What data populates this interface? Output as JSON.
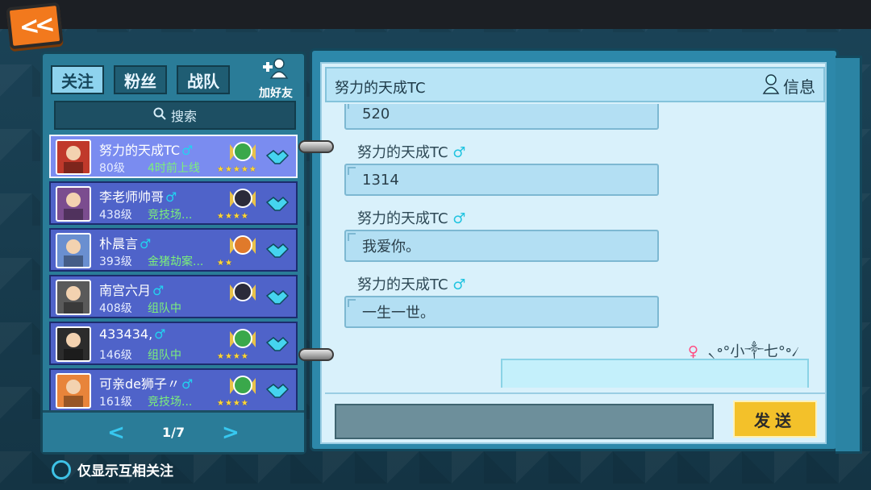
{
  "back_button": {
    "label": "<<"
  },
  "left_panel": {
    "tabs": [
      {
        "label": "关注",
        "active": true
      },
      {
        "label": "粉丝",
        "active": false
      },
      {
        "label": "战队",
        "active": false
      }
    ],
    "add_friend": {
      "icon": "+",
      "label": "加好友"
    },
    "search": {
      "icon": "search-icon",
      "label": "搜索"
    },
    "friends": [
      {
        "name": "努力的天成TC",
        "gender": "♂",
        "level": "80级",
        "status": "4时前上线",
        "stars": "★★★★★",
        "badge_color": "#3aa84b",
        "avatar_color": "#c0392b",
        "selected": true
      },
      {
        "name": "李老师帅哥",
        "gender": "♂",
        "level": "438级",
        "status": "竞技场...",
        "stars": "★★★★",
        "badge_color": "#2b2b3a",
        "avatar_color": "#7b4d8f",
        "selected": false
      },
      {
        "name": "朴晨言",
        "gender": "♂",
        "level": "393级",
        "status": "金猪劫案...",
        "stars": "★★",
        "badge_color": "#e07a2b",
        "avatar_color": "#6a8fd0",
        "selected": false
      },
      {
        "name": "南宫六月",
        "gender": "♂",
        "level": "408级",
        "status": "组队中",
        "stars": "",
        "badge_color": "#2b2b3a",
        "avatar_color": "#5a5a5a",
        "selected": false
      },
      {
        "name": "433434,",
        "gender": "♂",
        "level": "146级",
        "status": "组队中",
        "stars": "★★★★",
        "badge_color": "#3aa84b",
        "avatar_color": "#2c2c2c",
        "selected": false
      },
      {
        "name": "可亲de狮子〃",
        "gender": "♂",
        "level": "161级",
        "status": "竞技场...",
        "stars": "★★★★",
        "badge_color": "#3aa84b",
        "avatar_color": "#e8843a",
        "selected": false
      }
    ],
    "pager": {
      "prev": "<",
      "page": "1/7",
      "next": ">"
    },
    "mutual_toggle": {
      "label": "仅显示互相关注"
    }
  },
  "chat": {
    "title": "努力的天成TC",
    "info_label": "信息",
    "messages": [
      {
        "sender": "",
        "gender": "",
        "text": "520"
      },
      {
        "sender": "努力的天成TC",
        "gender": "♂",
        "text": "1314"
      },
      {
        "sender": "努力的天成TC",
        "gender": "♂",
        "text": "我爱你。"
      },
      {
        "sender": "努力的天成TC",
        "gender": "♂",
        "text": "一生一世。"
      }
    ],
    "my_message": {
      "gender": "♀",
      "sender": "৲॰°小༒七°॰৴",
      "text": ""
    },
    "input_placeholder": "",
    "send_label": "发送"
  }
}
